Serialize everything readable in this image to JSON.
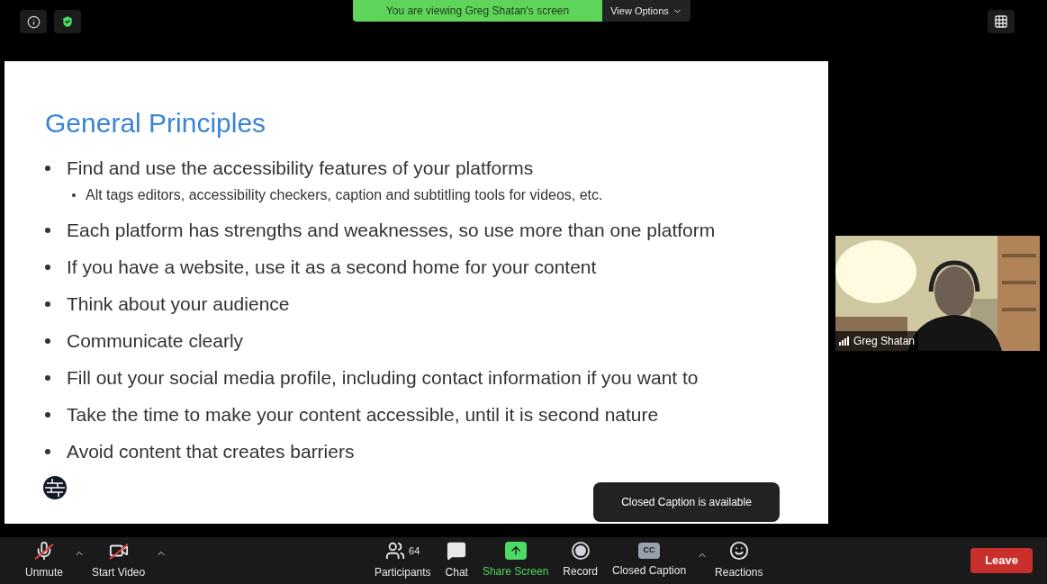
{
  "banner": {
    "text": "You are viewing Greg Shatan's screen",
    "options": "View Options"
  },
  "slide": {
    "title": "General Principles",
    "bullets": [
      {
        "text": "Find and use the accessibility features of your platforms",
        "children": [
          {
            "text": "Alt tags editors, accessibility checkers, caption and subtitling tools for videos, etc."
          }
        ]
      },
      {
        "text": "Each platform has strengths and weaknesses, so use more than one platform"
      },
      {
        "text": "If you have a website, use it as a second home for your content"
      },
      {
        "text": "Think about your audience"
      },
      {
        "text": "Communicate clearly"
      },
      {
        "text": "Fill out your social media profile, including contact information if you want to"
      },
      {
        "text": "Take the time to make your content accessible, until it is second nature"
      },
      {
        "text": "Avoid content that creates barriers"
      }
    ]
  },
  "video": {
    "name": "Greg Shatan"
  },
  "tooltip": "Closed Caption is available",
  "toolbar": [
    {
      "kind": "mic",
      "label": "Unmute",
      "off": true,
      "caret": true
    },
    {
      "kind": "camera",
      "label": "Start Video",
      "off": true,
      "caret": true
    },
    {
      "kind": "spacer"
    },
    {
      "kind": "participants",
      "label": "Participants",
      "count": "64"
    },
    {
      "kind": "chat",
      "label": "Chat"
    },
    {
      "kind": "share",
      "label": "Share Screen"
    },
    {
      "kind": "record",
      "label": "Record"
    },
    {
      "kind": "cc",
      "label": "Closed Caption",
      "caret": true,
      "glyph": "CC"
    },
    {
      "kind": "reactions",
      "label": "Reactions"
    },
    {
      "kind": "spacer"
    },
    {
      "kind": "leave",
      "label": "Leave"
    }
  ]
}
